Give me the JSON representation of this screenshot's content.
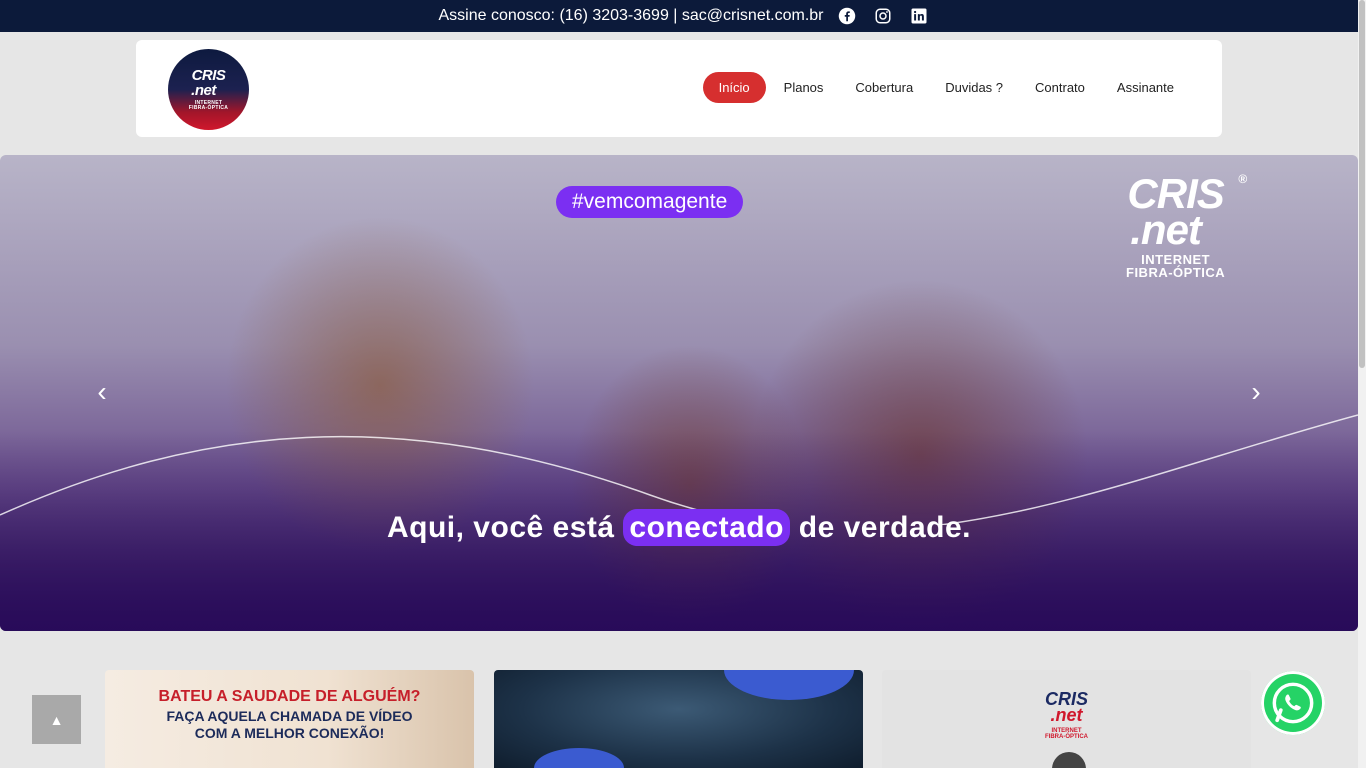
{
  "topbar": {
    "contact": "Assine conosco: (16) 3203-3699 | sac@crisnet.com.br",
    "social": [
      "facebook-icon",
      "instagram-icon",
      "linkedin-icon"
    ]
  },
  "header": {
    "logo": {
      "line1": "CRIS",
      "line2": ".net",
      "line3": "INTERNET",
      "line4": "FIBRA-ÓPTICA"
    },
    "nav": [
      "Início",
      "Planos",
      "Cobertura",
      "Duvidas ?",
      "Contrato",
      "Assinante"
    ],
    "active": "Início"
  },
  "hero": {
    "hashtag": "#vemcomagente",
    "brand": {
      "line1": "CRIS",
      "line2": ".net",
      "line3": "INTERNET",
      "line4": "FIBRA-ÓPTICA",
      "reg": "®"
    },
    "tagline_before": "Aqui, você está ",
    "tagline_highlight": "conectado",
    "tagline_after": " de verdade.",
    "prev": "‹",
    "next": "›"
  },
  "cards": {
    "card1": {
      "line1": "BATEU A SAUDADE DE ALGUÉM?",
      "line2": "FAÇA AQUELA CHAMADA DE VÍDEO",
      "line3": "COM A MELHOR CONEXÃO!"
    },
    "card3": {
      "line1": "CRIS",
      "line2": ".net",
      "line3": "INTERNET",
      "line4": "FIBRA-ÓPTICA"
    }
  },
  "floating": {
    "back_to_top": "▲",
    "whatsapp": "whatsapp-icon"
  },
  "colors": {
    "topbar": "#0c1a3a",
    "accent": "#d62f2f",
    "purple": "#7b2ff2",
    "whatsapp": "#25d366"
  }
}
